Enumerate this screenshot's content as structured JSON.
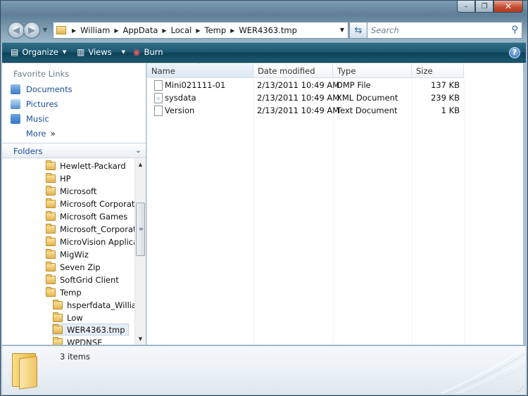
{
  "window": {
    "caption_buttons": [
      "–",
      "❐",
      "✕"
    ]
  },
  "nav": {
    "breadcrumbs": [
      "William",
      "AppData",
      "Local",
      "Temp",
      "WER4363.tmp"
    ],
    "search_placeholder": "Search"
  },
  "toolbar": {
    "organize": "Organize",
    "views": "Views",
    "burn": "Burn",
    "help": "?"
  },
  "left": {
    "favorites_title": "Favorite Links",
    "favorites": [
      {
        "label": "Documents",
        "color": "#3a79c8"
      },
      {
        "label": "Pictures",
        "color": "#4f8fd0"
      },
      {
        "label": "Music",
        "color": "#2f76c2"
      },
      {
        "label": "More",
        "color": "#ffffff"
      }
    ],
    "more_arrows": "»",
    "folders_title": "Folders",
    "tree": [
      {
        "label": "Hewlett-Packard",
        "indent": 1
      },
      {
        "label": "HP",
        "indent": 1
      },
      {
        "label": "Microsoft",
        "indent": 1
      },
      {
        "label": "Microsoft Corporation",
        "indent": 1
      },
      {
        "label": "Microsoft Games",
        "indent": 1
      },
      {
        "label": "Microsoft_Corporation",
        "indent": 1
      },
      {
        "label": "MicroVision Applications",
        "indent": 1
      },
      {
        "label": "MigWiz",
        "indent": 1
      },
      {
        "label": "Seven Zip",
        "indent": 1
      },
      {
        "label": "SoftGrid Client",
        "indent": 1
      },
      {
        "label": "Temp",
        "indent": 1
      },
      {
        "label": "hsperfdata_William",
        "indent": 2
      },
      {
        "label": "Low",
        "indent": 2
      },
      {
        "label": "WER4363.tmp",
        "indent": 2,
        "selected": true
      },
      {
        "label": "WPDNSE",
        "indent": 2
      }
    ]
  },
  "files": {
    "columns": [
      "Name",
      "Date modified",
      "Type",
      "Size"
    ],
    "rows": [
      {
        "name": "Mini021111-01",
        "date": "2/13/2011 10:49 AM",
        "type": "DMP File",
        "size": "137 KB",
        "icon": "document-icon"
      },
      {
        "name": "sysdata",
        "date": "2/13/2011 10:49 AM",
        "type": "XML Document",
        "size": "239 KB",
        "icon": "xml-document-icon"
      },
      {
        "name": "Version",
        "date": "2/13/2011 10:49 AM",
        "type": "Text Document",
        "size": "1 KB",
        "icon": "text-document-icon"
      }
    ]
  },
  "details": {
    "item_count": "3 items"
  },
  "colors": {
    "accent": "#1a4f9b",
    "toolbar": "#1e5872",
    "close_button": "#c84f32"
  }
}
